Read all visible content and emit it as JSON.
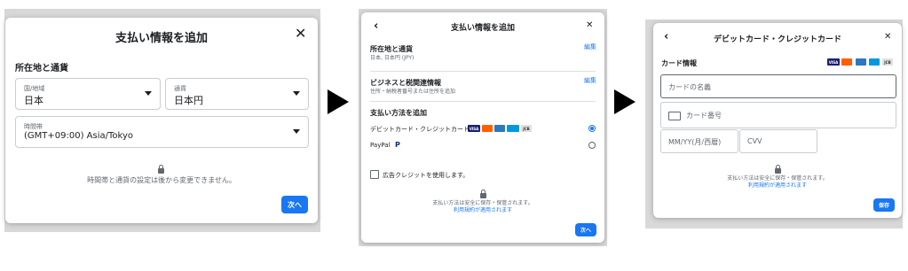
{
  "screen1": {
    "title": "支払い情報を追加",
    "section_title": "所在地と通貨",
    "country": {
      "label": "国/地域",
      "value": "日本"
    },
    "currency": {
      "label": "通貨",
      "value": "日本円"
    },
    "timezone": {
      "label": "時間帯",
      "value": "(GMT+09:00) Asia/Tokyo"
    },
    "note": "時間帯と通貨の設定は後から変更できません。",
    "next_label": "次へ"
  },
  "screen2": {
    "title": "支払い情報を追加",
    "location": {
      "title": "所在地と通貨",
      "value": "日本, 日本円 (JPY)",
      "edit": "編集"
    },
    "business": {
      "title": "ビジネスと税関連情報",
      "value": "住所・納税者番号または住所を追加",
      "edit": "編集"
    },
    "payment_title": "支払い方法を追加",
    "method_card": "デビットカード・クレジットカード",
    "method_paypal": "PayPal",
    "ad_credit": "広告クレジットを使用します。",
    "secure_note": "支払い方法は安全に保存・保管されます。",
    "terms": "利用規約が適用されます",
    "next_label": "次へ"
  },
  "screen3": {
    "title": "デビットカード・クレジットカード",
    "section_title": "カード情報",
    "name_placeholder": "カードの名義",
    "number_placeholder": "カード番号",
    "expiry_placeholder": "MM/YY(月/西暦)",
    "cvv_placeholder": "CVV",
    "secure_note": "支払い方法は安全に保存・保管されます。",
    "terms": "利用規約が適用されます",
    "save_label": "保存"
  },
  "card_brands": [
    "VISA",
    "MC",
    "AMEX",
    "JCB"
  ],
  "colors": {
    "accent": "#1877f2",
    "text": "#1c1e21",
    "muted": "#606770",
    "border": "#c9ccd1"
  }
}
